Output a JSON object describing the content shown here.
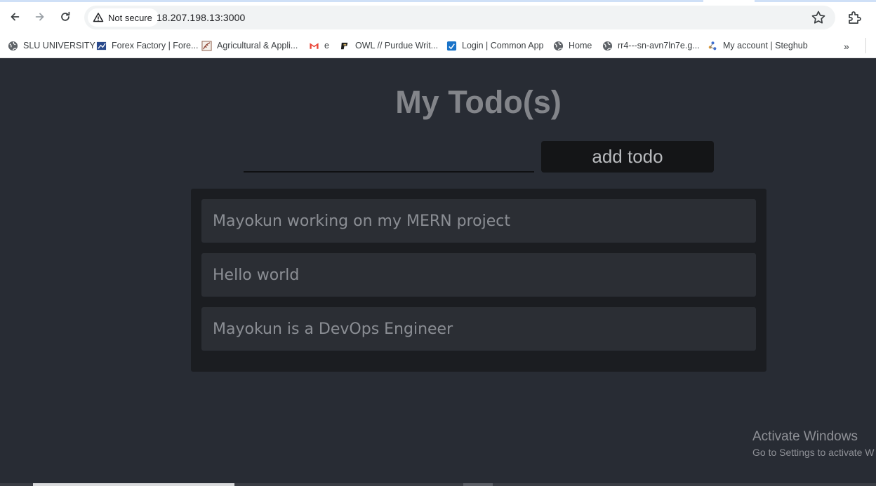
{
  "browser": {
    "security_label": "Not secure",
    "url": "18.207.198.13:3000",
    "bookmarks": [
      {
        "label": "SLU UNIVERSITY",
        "icon": "globe-icon"
      },
      {
        "label": "Forex Factory | Fore...",
        "icon": "forex-factory-icon"
      },
      {
        "label": "Agricultural & Appli...",
        "icon": "agri-icon"
      },
      {
        "label": "e",
        "icon": "gmail-icon"
      },
      {
        "label": "OWL // Purdue Writ...",
        "icon": "purdue-icon"
      },
      {
        "label": "Login | Common App",
        "icon": "common-app-icon"
      },
      {
        "label": "Home",
        "icon": "globe-icon"
      },
      {
        "label": "rr4---sn-avn7ln7e.g...",
        "icon": "globe-icon"
      },
      {
        "label": "My account | Steghub",
        "icon": "steghub-icon"
      }
    ],
    "overflow_label": "»"
  },
  "app": {
    "title": "My Todo(s)",
    "input_value": "",
    "add_button_label": "add todo",
    "todos": [
      "Mayokun working on my MERN project",
      "Hello world",
      "Mayokun is a DevOps Engineer"
    ]
  },
  "watermark": {
    "line1": "Activate Windows",
    "line2": "Go to Settings to activate W"
  },
  "colors": {
    "page_bg": "#282c34",
    "list_bg": "#1b1d21",
    "item_bg": "#2b2e34",
    "button_bg": "#141517"
  }
}
